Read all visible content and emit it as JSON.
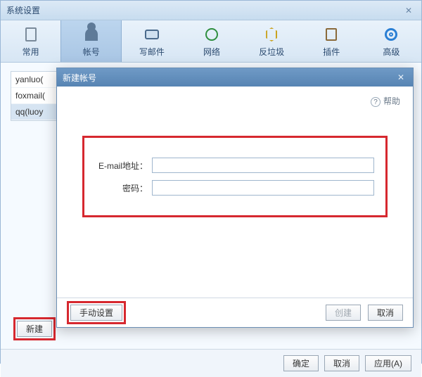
{
  "window": {
    "title": "系统设置",
    "close": "✕"
  },
  "toolbar": {
    "items": [
      {
        "label": "常用"
      },
      {
        "label": "帐号"
      },
      {
        "label": "写邮件"
      },
      {
        "label": "网络"
      },
      {
        "label": "反垃圾"
      },
      {
        "label": "插件"
      },
      {
        "label": "高级"
      }
    ]
  },
  "accounts": {
    "items": [
      {
        "label": "yanluo("
      },
      {
        "label": "foxmail("
      },
      {
        "label": "qq(luoy"
      }
    ]
  },
  "buttons": {
    "new": "新建",
    "ok": "确定",
    "cancel": "取消",
    "apply": "应用(A)"
  },
  "modal": {
    "title": "新建帐号",
    "close": "✕",
    "help": "帮助",
    "email_label": "E-mail地址：",
    "password_label": "密码：",
    "email_value": "",
    "password_value": "",
    "manual": "手动设置",
    "create": "创建",
    "cancel": "取消"
  }
}
